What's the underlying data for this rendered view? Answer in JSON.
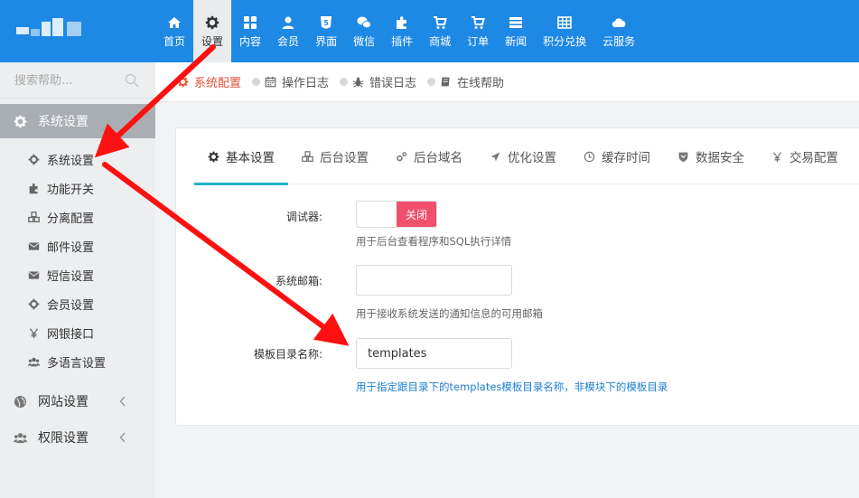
{
  "nav": {
    "items": [
      {
        "label": "首页",
        "icon": "home-icon"
      },
      {
        "label": "设置",
        "icon": "gear-icon"
      },
      {
        "label": "内容",
        "icon": "grid-icon"
      },
      {
        "label": "会员",
        "icon": "user-icon"
      },
      {
        "label": "界面",
        "icon": "html5-icon"
      },
      {
        "label": "微信",
        "icon": "wechat-icon"
      },
      {
        "label": "插件",
        "icon": "puzzle-icon"
      },
      {
        "label": "商城",
        "icon": "cart-icon"
      },
      {
        "label": "订单",
        "icon": "cart-icon"
      },
      {
        "label": "新闻",
        "icon": "server-icon"
      },
      {
        "label": "积分兑换",
        "icon": "table-icon"
      },
      {
        "label": "云服务",
        "icon": "cloud-icon"
      }
    ],
    "active_index": 1
  },
  "sidebar": {
    "search_placeholder": "搜索帮助...",
    "groups": [
      {
        "label": "系统设置",
        "icon": "gear-icon"
      },
      {
        "label": "网站设置",
        "icon": "globe-icon"
      },
      {
        "label": "权限设置",
        "icon": "users-icon"
      }
    ],
    "items": [
      {
        "label": "系统设置",
        "icon": "gear-icon"
      },
      {
        "label": "功能开关",
        "icon": "puzzle-icon"
      },
      {
        "label": "分离配置",
        "icon": "cubes-icon"
      },
      {
        "label": "邮件设置",
        "icon": "envelope-icon"
      },
      {
        "label": "短信设置",
        "icon": "envelope-icon"
      },
      {
        "label": "会员设置",
        "icon": "gear-icon"
      },
      {
        "label": "网银接口",
        "icon": "yen-icon"
      },
      {
        "label": "多语言设置",
        "icon": "users-icon"
      }
    ]
  },
  "breadcrumbs": [
    {
      "label": "系统配置",
      "icon": "gear-icon"
    },
    {
      "label": "操作日志",
      "icon": "calendar-icon"
    },
    {
      "label": "错误日志",
      "icon": "bug-icon"
    },
    {
      "label": "在线帮助",
      "icon": "book-icon"
    }
  ],
  "tabs": [
    {
      "label": "基本设置",
      "icon": "gear-icon"
    },
    {
      "label": "后台设置",
      "icon": "cubes-icon"
    },
    {
      "label": "后台域名",
      "icon": "gears-icon"
    },
    {
      "label": "优化设置",
      "icon": "send-icon"
    },
    {
      "label": "缓存时间",
      "icon": "clock-icon"
    },
    {
      "label": "数据安全",
      "icon": "shield-icon"
    },
    {
      "label": "交易配置",
      "icon": "yen-icon"
    }
  ],
  "form": {
    "debug_label": "调试器:",
    "debug_state": "关闭",
    "debug_help": "用于后台查看程序和SQL执行详情",
    "email_label": "系统邮箱:",
    "email_value": "",
    "email_help": "用于接收系统发送的通知信息的可用邮箱",
    "tpl_label": "模板目录名称:",
    "tpl_value": "templates",
    "tpl_help": "用于指定跟目录下的templates模板目录名称，非模块下的模板目录"
  },
  "colors": {
    "topbar": "#1e88e5",
    "accent_tab": "#1fb5c9",
    "toggle_off": "#f0506e",
    "breadcrumb_active": "#e0533a",
    "annotation_arrow": "#ff1010"
  }
}
